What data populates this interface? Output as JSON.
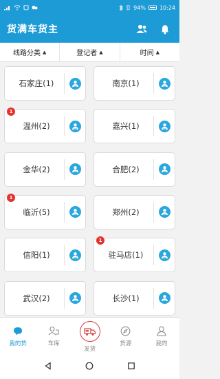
{
  "status": {
    "left_text": "",
    "battery": "94%",
    "time": "10:24"
  },
  "app": {
    "title": "货满车货主"
  },
  "filters": [
    {
      "label": "线路分类"
    },
    {
      "label": "登记者"
    },
    {
      "label": "时间"
    }
  ],
  "cards": [
    {
      "name": "石家庄(1)",
      "badge": ""
    },
    {
      "name": "南京(1)",
      "badge": ""
    },
    {
      "name": "温州(2)",
      "badge": "1"
    },
    {
      "name": "嘉兴(1)",
      "badge": ""
    },
    {
      "name": "金华(2)",
      "badge": ""
    },
    {
      "name": "合肥(2)",
      "badge": ""
    },
    {
      "name": "临沂(5)",
      "badge": "1"
    },
    {
      "name": "郑州(2)",
      "badge": ""
    },
    {
      "name": "信阳(1)",
      "badge": ""
    },
    {
      "name": "驻马店(1)",
      "badge": "1"
    },
    {
      "name": "武汉(2)",
      "badge": ""
    },
    {
      "name": "长沙(1)",
      "badge": ""
    }
  ],
  "tabs": [
    {
      "label": "我的货",
      "icon": "chat-bubble-icon"
    },
    {
      "label": "车库",
      "icon": "garage-icon"
    },
    {
      "label": "发货",
      "icon": "truck-icon"
    },
    {
      "label": "货源",
      "icon": "compass-icon"
    },
    {
      "label": "我的",
      "icon": "profile-icon"
    }
  ],
  "colors": {
    "primary": "#1d9bd6",
    "badge": "#e5322d",
    "center_ring": "#d93a3a"
  }
}
